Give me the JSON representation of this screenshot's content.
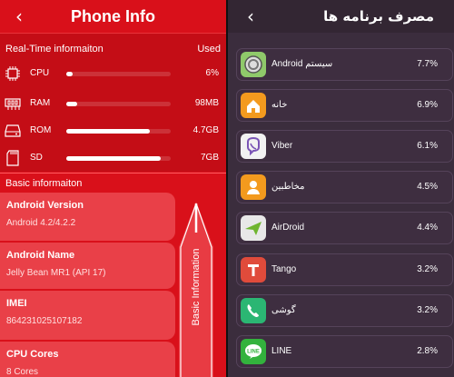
{
  "left": {
    "title": "Phone Info",
    "realtime_label": "Real-Time informaiton",
    "used_label": "Used",
    "metrics": [
      {
        "label": "CPU",
        "value": "6%",
        "fill": 0.06
      },
      {
        "label": "RAM",
        "value": "98MB",
        "fill": 0.1
      },
      {
        "label": "ROM",
        "value": "4.7GB",
        "fill": 0.8
      },
      {
        "label": "SD",
        "value": "7GB",
        "fill": 0.9
      }
    ],
    "basic_label": "Basic informaiton",
    "info": [
      {
        "key": "Android Version",
        "value": "Android 4.2/4.2.2"
      },
      {
        "key": "Android Name",
        "value": "Jelly Bean MR1 (API 17)"
      },
      {
        "key": "IMEI",
        "value": "864231025107182"
      },
      {
        "key": "CPU Cores",
        "value": "8 Cores"
      }
    ],
    "side_tab_label": "Basic  Information"
  },
  "right": {
    "title": "مصرف برنامه ها",
    "apps": [
      {
        "name": "Android سیستم",
        "pct": "7.7%",
        "icon": "android-system-icon",
        "color": "#6a9e3a"
      },
      {
        "name": "خانه",
        "pct": "6.9%",
        "icon": "home-icon",
        "color": "#f39a1e"
      },
      {
        "name": "Viber",
        "pct": "6.1%",
        "icon": "viber-icon",
        "color": "#7b55b6"
      },
      {
        "name": "مخاطبین",
        "pct": "4.5%",
        "icon": "contacts-icon",
        "color": "#f39a1e"
      },
      {
        "name": "AirDroid",
        "pct": "4.4%",
        "icon": "airdroid-icon",
        "color": "#6fb52f"
      },
      {
        "name": "Tango",
        "pct": "3.2%",
        "icon": "tango-icon",
        "color": "#e04b3b"
      },
      {
        "name": "گوشی",
        "pct": "3.2%",
        "icon": "phone-icon",
        "color": "#2bb673"
      },
      {
        "name": "LINE",
        "pct": "2.8%",
        "icon": "line-icon",
        "color": "#33b23d"
      }
    ]
  }
}
